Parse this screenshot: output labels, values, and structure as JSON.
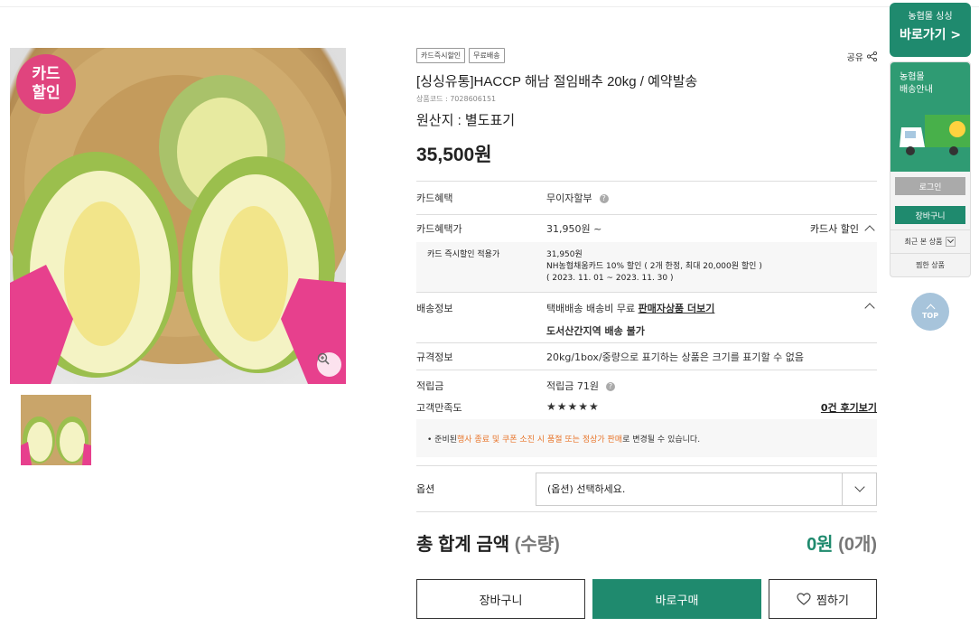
{
  "badge": {
    "line1": "카드",
    "line2": "할인"
  },
  "product": {
    "tags": [
      "카드즉시할인",
      "무료배송"
    ],
    "share_label": "공유",
    "title": "[싱싱유통]HACCP 해남 절임배추 20kg / 예약발송",
    "code": "상품코드 : 7028606151",
    "origin": "원산지 : 별도표기",
    "price": "35,500원"
  },
  "details": {
    "card_benefit": {
      "label": "카드혜택",
      "value": "무이자할부"
    },
    "card_price": {
      "label": "카드혜택가",
      "value": "31,950원 ~",
      "action": "카드사 할인"
    },
    "instant": {
      "label": "카드 즉시할인 적용가",
      "line1": "31,950원",
      "line2": "NH농협채움카드  10% 할인 ( 2개 한정,  최대 20,000원 할인 )",
      "line3": "( 2023. 11. 01 ~ 2023. 11. 30 )"
    },
    "shipping": {
      "label": "배송정보",
      "value_pre": "택배배송 배송비 무료 ",
      "link": "판매자상품 더보기",
      "line2": "도서산간지역 배송 불가"
    },
    "spec": {
      "label": "규격정보",
      "value": "20kg/1box/중량으로 표기하는 상품은 크기를 표기할 수 없음"
    },
    "points": {
      "label": "적립금",
      "value": "적립금 71원"
    },
    "satisfaction": {
      "label": "고객만족도",
      "stars": "★★★★★",
      "reviews": "0건 후기보기"
    },
    "notice": {
      "pre": "• 준비된 ",
      "highlight": "행사 종료 및 쿠폰 소진 시 품절 또는 정상가 판매",
      "post": "로 변경될 수 있습니다."
    }
  },
  "option": {
    "label": "옵션",
    "placeholder": "(옵션) 선택하세요."
  },
  "total": {
    "label": "총 합계 금액",
    "qty_label": "(수량)",
    "amount": "0원",
    "count": "(0개)"
  },
  "buttons": {
    "cart": "장바구니",
    "buy": "바로구매",
    "wish": "찜하기"
  },
  "sidebar": {
    "banner_small": "농협몰 싱싱",
    "banner_big": "바로가기 >",
    "delivery_line1": "농협몰",
    "delivery_line2": "배송안내",
    "login": "로그인",
    "cart": "장바구니",
    "recent": "최근 본 상품",
    "wish": "찜한 상품",
    "top": "TOP"
  },
  "colors": {
    "brand_green": "#1f8a6e",
    "badge_pink": "#e0447e",
    "notice_orange": "#e8762c"
  }
}
